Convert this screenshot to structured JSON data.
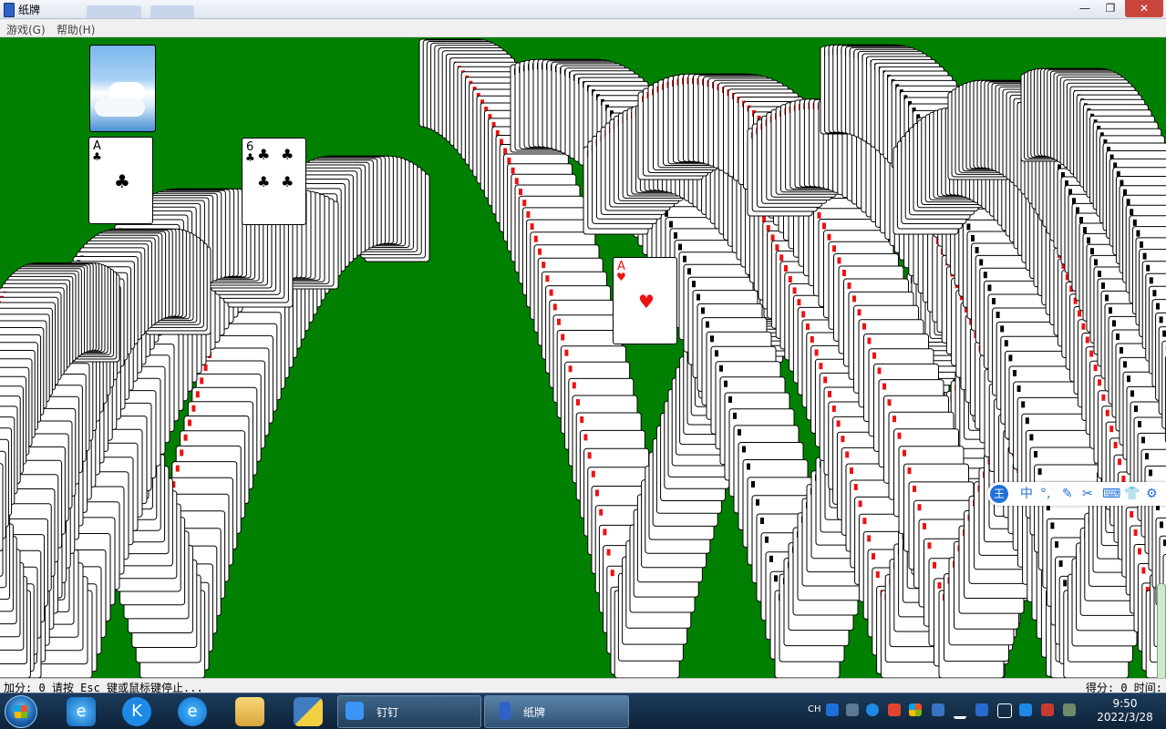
{
  "window": {
    "title": "纸牌",
    "minimize_glyph": "—",
    "maximize_glyph": "❐",
    "close_glyph": "✕"
  },
  "menu": {
    "game": "游戏(G)",
    "help": "帮助(H)"
  },
  "cards": {
    "foundation_1": {
      "rank": "A",
      "suit": "♣"
    },
    "foundation_2": {
      "rank": "6",
      "suit": "♣"
    },
    "center": {
      "rank": "A",
      "suit": "♥"
    }
  },
  "status": {
    "left": "加分: 0  请按 Esc 键或鼠标键停止...",
    "right": "得分: 0 时间:"
  },
  "ime": {
    "logo": "王",
    "mode": "中",
    "punct": "°,",
    "pen": "✎",
    "scissors": "✂",
    "keyboard": "⌨",
    "skin": "👕",
    "settings": "⚙"
  },
  "taskbar": {
    "tasks": [
      {
        "label": "钉钉",
        "icon": "dingtalk-icon"
      },
      {
        "label": "纸牌",
        "icon": "solitaire-icon"
      }
    ],
    "tray": {
      "lang": "CH"
    },
    "clock": {
      "time": "9:50",
      "date": "2022/3/28"
    }
  },
  "colors": {
    "felt": "#008000",
    "red_suit": "#ee1111",
    "taskbar": "#1c3b5a"
  }
}
